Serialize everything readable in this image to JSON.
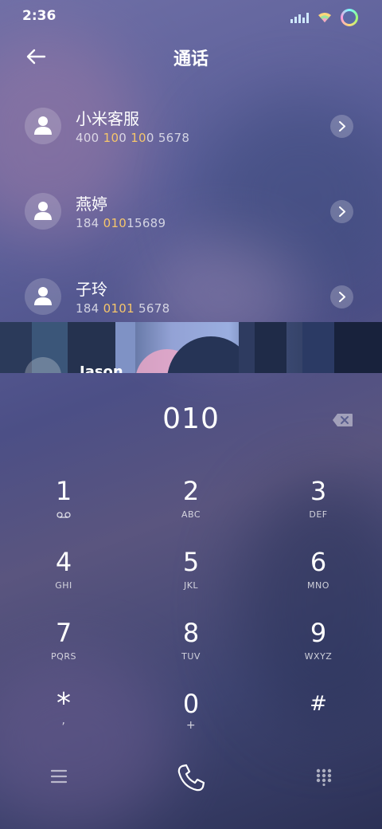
{
  "status": {
    "time": "2:36"
  },
  "header": {
    "title": "通话"
  },
  "contacts": [
    {
      "name": "小米客服",
      "number_pre": "400 ",
      "number_hl": "10",
      "number_mid": "0 ",
      "number_hl2": "10",
      "number_post": "0 5678"
    },
    {
      "name": "燕婷",
      "number_pre": "184 ",
      "number_hl": "010",
      "number_mid": "",
      "number_hl2": "",
      "number_post": "15689"
    },
    {
      "name": "子玲",
      "number_pre": "184 ",
      "number_hl": "0101",
      "number_mid": "",
      "number_hl2": "",
      "number_post": " 5678"
    }
  ],
  "partial_contact": {
    "name": "Jason"
  },
  "dialer": {
    "number": "010"
  },
  "keys": [
    {
      "digit": "1",
      "letters": ""
    },
    {
      "digit": "2",
      "letters": "ABC"
    },
    {
      "digit": "3",
      "letters": "DEF"
    },
    {
      "digit": "4",
      "letters": "GHI"
    },
    {
      "digit": "5",
      "letters": "JKL"
    },
    {
      "digit": "6",
      "letters": "MNO"
    },
    {
      "digit": "7",
      "letters": "PQRS"
    },
    {
      "digit": "8",
      "letters": "TUV"
    },
    {
      "digit": "9",
      "letters": "WXYZ"
    },
    {
      "digit": "*",
      "letters": ","
    },
    {
      "digit": "0",
      "letters": "+"
    },
    {
      "digit": "#",
      "letters": ""
    }
  ],
  "icons": {
    "back": "arrow-left-icon",
    "chevron": "chevron-right-icon",
    "backspace": "backspace-icon",
    "voicemail": "voicemail-icon",
    "menu": "menu-icon",
    "call": "phone-icon",
    "dialpad": "dialpad-icon"
  },
  "colors": {
    "highlight": "#f6c66b"
  }
}
